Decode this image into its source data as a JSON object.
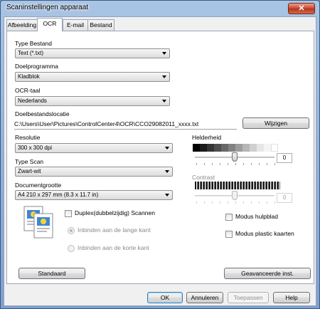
{
  "window": {
    "title": "Scaninstellingen apparaat",
    "close_glyph": "✕"
  },
  "tabs": [
    {
      "label": "Afbeelding"
    },
    {
      "label": "OCR"
    },
    {
      "label": "E-mail"
    },
    {
      "label": "Bestand"
    }
  ],
  "active_tab": "OCR",
  "file_type": {
    "label": "Type Bestand",
    "value": "Text (*.txt)"
  },
  "target_app": {
    "label": "Doelprogramma",
    "value": "Kladblok"
  },
  "ocr_language": {
    "label": "OCR-taal",
    "value": "Nederlands"
  },
  "destination": {
    "label": "Doelbestandslocatie",
    "path": "C:\\Users\\User\\Pictures\\ControlCenter4\\OCR\\CCO29082011_xxxx.txt",
    "change_button": "Wijzigen"
  },
  "resolution": {
    "label": "Resolutie",
    "value": "300 x 300 dpi"
  },
  "scan_type": {
    "label": "Type Scan",
    "value": "Zwart-wit"
  },
  "document_size": {
    "label": "Documentgrootte",
    "value": "A4 210 x 297 mm (8.3 x 11.7 in)"
  },
  "brightness": {
    "label": "Helderheid",
    "value": "0",
    "slider_fraction": 0.5
  },
  "contrast": {
    "label": "Contrast",
    "value": "0",
    "slider_fraction": 0.5,
    "enabled": false
  },
  "duplex": {
    "label": "Duplex(dubbelzijdig) Scannen",
    "checked": false
  },
  "binding": {
    "long_edge": {
      "label": "Inbinden aan de lange kant",
      "selected": true,
      "enabled": false
    },
    "short_edge": {
      "label": "Inbinden aan de korte kant",
      "selected": false,
      "enabled": false
    }
  },
  "carrier_sheet": {
    "label": "Modus hulpblad",
    "checked": false
  },
  "plastic_card": {
    "label": "Modus plastic kaarten",
    "checked": false
  },
  "buttons": {
    "default": "Standaard",
    "advanced": "Geavanceerde inst.",
    "ok": "OK",
    "cancel": "Annuleren",
    "apply": "Toepassen",
    "help": "Help"
  },
  "colors": {
    "title_gradient_top": "#a9c4e4",
    "close_button": "#c9452b",
    "dialog_bg": "#f0f0f0",
    "panel_bg": "#ffffff"
  }
}
